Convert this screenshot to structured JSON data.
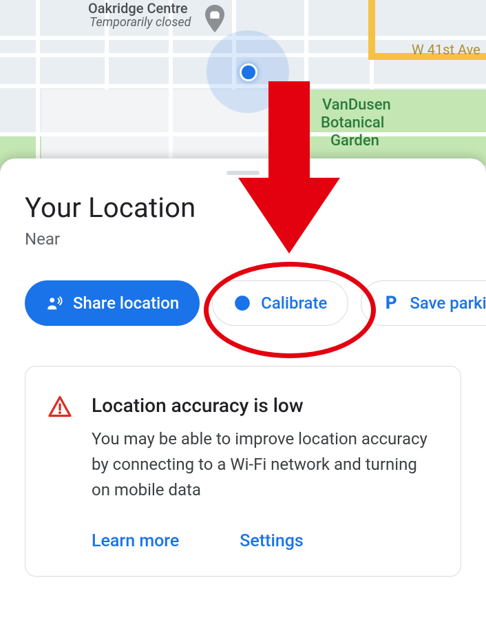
{
  "map": {
    "poi": {
      "name": "Oakridge Centre",
      "status": "Temporarily closed"
    },
    "park": {
      "line1": "VanDusen",
      "line2": "Botanical",
      "line3": "Garden"
    },
    "road": "W 41st Ave"
  },
  "sheet": {
    "title": "Your Location",
    "subtitle": "Near"
  },
  "chips": {
    "share": "Share location",
    "calibrate": "Calibrate",
    "savepark": "Save parking"
  },
  "card": {
    "title": "Location accuracy is low",
    "text": "You may be able to improve location accuracy by connecting to a Wi-Fi network and turning on mobile data",
    "learn": "Learn more",
    "settings": "Settings"
  }
}
